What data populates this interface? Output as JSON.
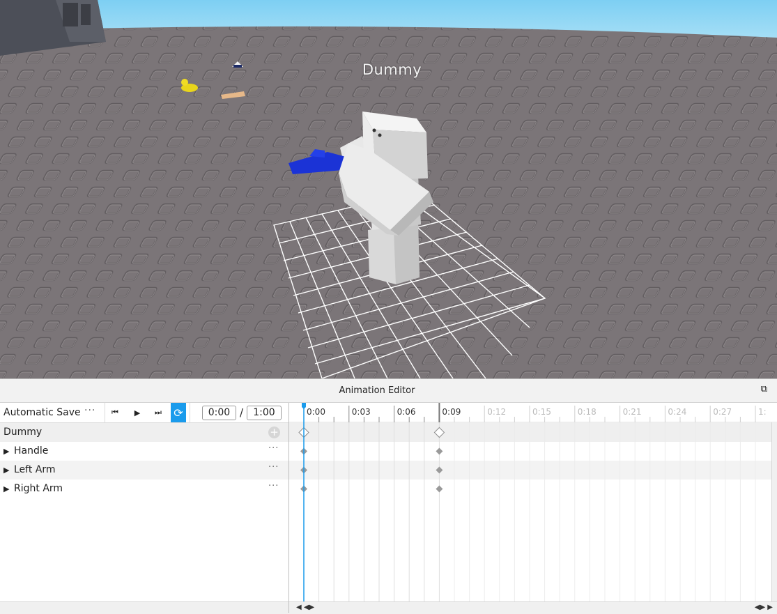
{
  "viewport": {
    "model_label": "Dummy",
    "sky_color": "#8fd6f5",
    "ground_color": "#7b7578",
    "grid_color": "#ffffff",
    "tool_color": "#1b33d6"
  },
  "editor": {
    "title": "Animation Editor",
    "restore_icon": "restore-window-icon",
    "toolbar": {
      "save_label": "Automatic Save",
      "more_label": "···",
      "current_time": "0:00",
      "separator": "/",
      "end_time": "1:00",
      "loop_color": "#1a9bec"
    },
    "tracks": [
      {
        "name": "Dummy",
        "expand": ""
      },
      {
        "name": "Handle",
        "expand": "▶"
      },
      {
        "name": "Left Arm",
        "expand": "▶"
      },
      {
        "name": "Right Arm",
        "expand": "▶"
      }
    ],
    "timeline": {
      "ticks": [
        "0:00",
        "0:03",
        "0:06",
        "0:09",
        "0:12",
        "0:15",
        "0:18",
        "0:21",
        "0:24",
        "0:27",
        "1:"
      ],
      "active_ticks": 4,
      "keyframe_times": [
        0,
        9
      ],
      "scrubber_time": 0,
      "scrubber_color": "#1a9bec"
    }
  }
}
